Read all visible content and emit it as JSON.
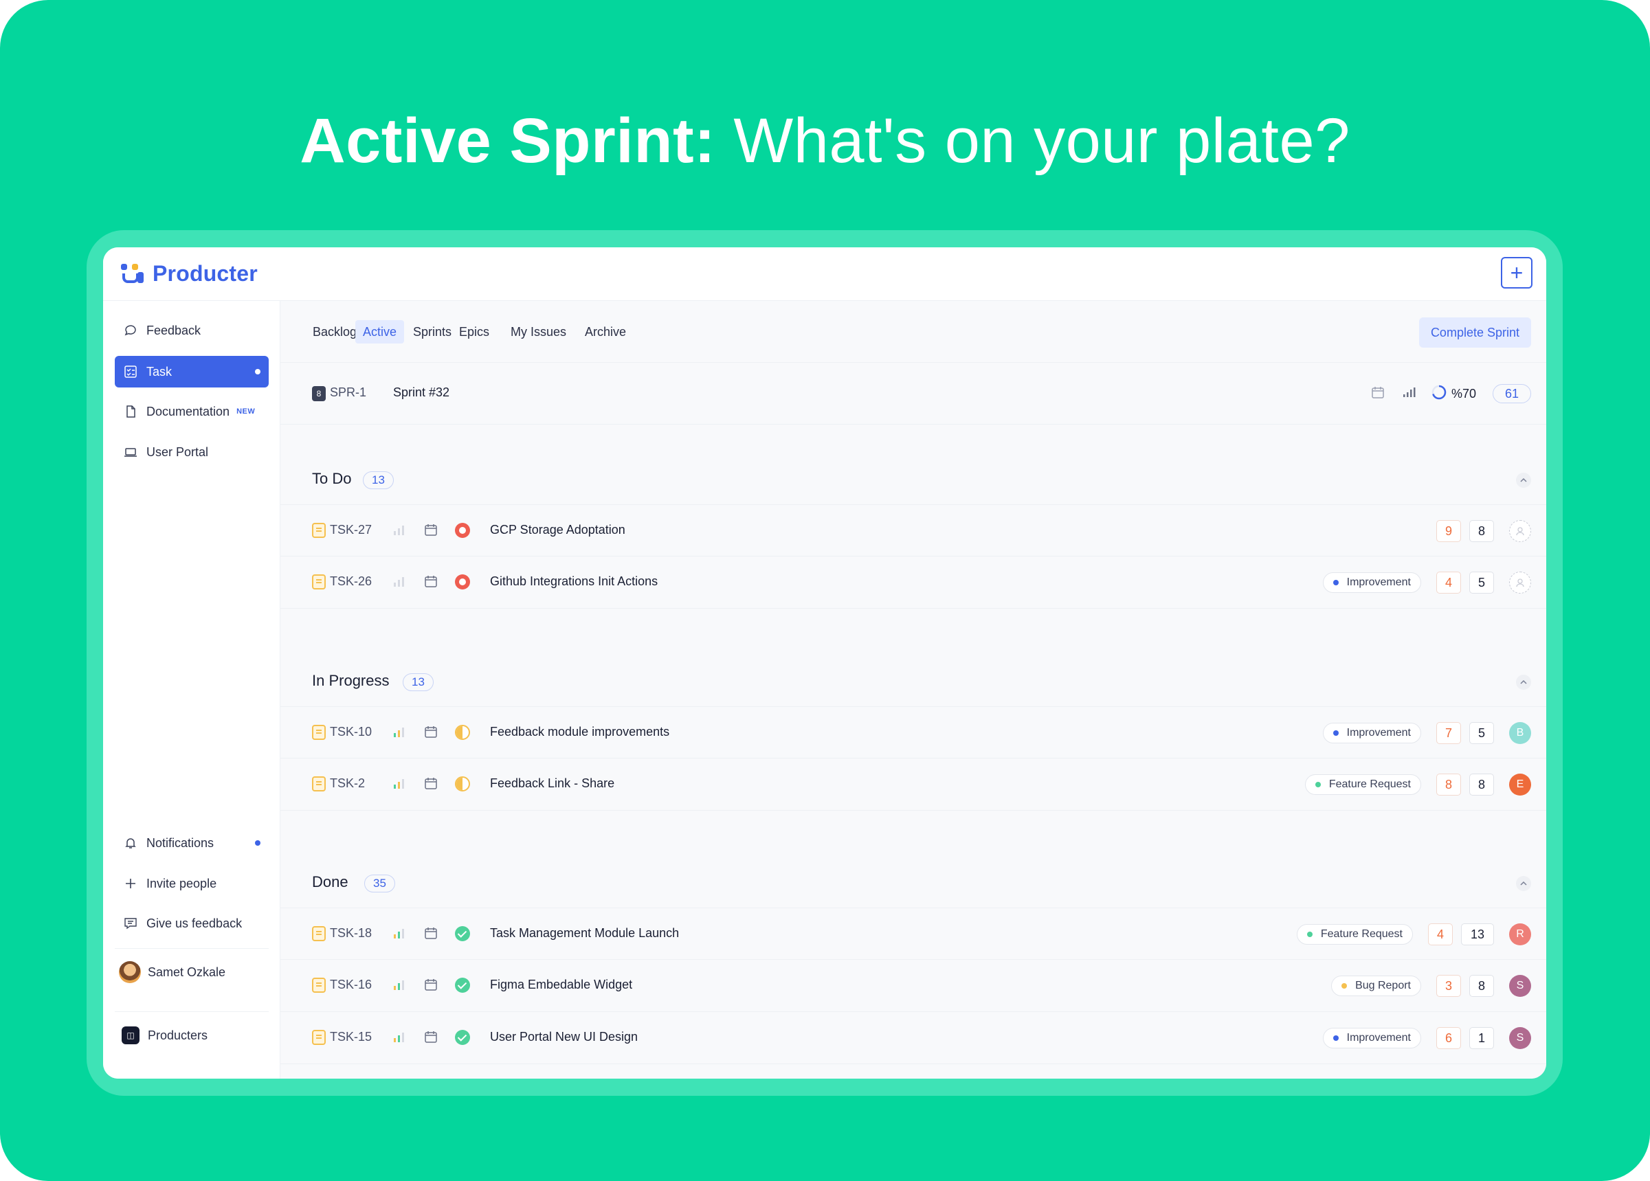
{
  "headline": {
    "bold": "Active Sprint:",
    "light": " What's on your plate?"
  },
  "brand": {
    "name": "Producter",
    "accent": "#3d63e6",
    "background": "#04d69c"
  },
  "sidebar": {
    "items": [
      {
        "label": "Feedback",
        "icon": "chat-bubble-icon"
      },
      {
        "label": "Task",
        "icon": "checklist-icon",
        "active": true
      },
      {
        "label": "Documentation",
        "icon": "document-icon",
        "badge": "NEW"
      },
      {
        "label": "User Portal",
        "icon": "laptop-icon"
      }
    ],
    "bottom": [
      {
        "label": "Notifications",
        "icon": "bell-icon"
      },
      {
        "label": "Invite people",
        "icon": "plus-icon"
      },
      {
        "label": "Give us feedback",
        "icon": "message-icon"
      }
    ],
    "user": {
      "name": "Samet Ozkale"
    },
    "org": {
      "name": "Producters"
    }
  },
  "tabs": [
    "Backlog",
    "Active",
    "Sprints",
    "Epics",
    "My Issues",
    "Archive"
  ],
  "active_tab": "Active",
  "complete_label": "Complete Sprint",
  "sprint": {
    "badge": "8",
    "id": "SPR-1",
    "name": "Sprint #32",
    "progress": "%70",
    "count": "61"
  },
  "sections": [
    {
      "title": "To Do",
      "count": "13",
      "rows": [
        {
          "id": "TSK-27",
          "title": "GCP Storage Adoptation",
          "status": "todo",
          "tag": "",
          "est": "9",
          "pts": "8",
          "avatar": ""
        },
        {
          "id": "TSK-26",
          "title": "Github Integrations Init Actions",
          "status": "todo",
          "tag": "Improvement",
          "est": "4",
          "pts": "5",
          "avatar": ""
        }
      ]
    },
    {
      "title": "In Progress",
      "count": "13",
      "rows": [
        {
          "id": "TSK-10",
          "title": "Feedback module improvements",
          "status": "prog",
          "tag": "Improvement",
          "est": "7",
          "pts": "5",
          "avatar": "B"
        },
        {
          "id": "TSK-2",
          "title": "Feedback Link - Share",
          "status": "prog",
          "tag": "Feature Request",
          "est": "8",
          "pts": "8",
          "avatar": "E"
        }
      ]
    },
    {
      "title": "Done",
      "count": "35",
      "rows": [
        {
          "id": "TSK-18",
          "title": "Task Management Module Launch",
          "status": "done",
          "tag": "Feature Request",
          "est": "4",
          "pts": "13",
          "avatar": "R"
        },
        {
          "id": "TSK-16",
          "title": "Figma Embedable Widget",
          "status": "done",
          "tag": "Bug Report",
          "est": "3",
          "pts": "8",
          "avatar": "S"
        },
        {
          "id": "TSK-15",
          "title": "User Portal New UI Design",
          "status": "done",
          "tag": "Improvement",
          "est": "6",
          "pts": "1",
          "avatar": "S"
        }
      ]
    }
  ]
}
